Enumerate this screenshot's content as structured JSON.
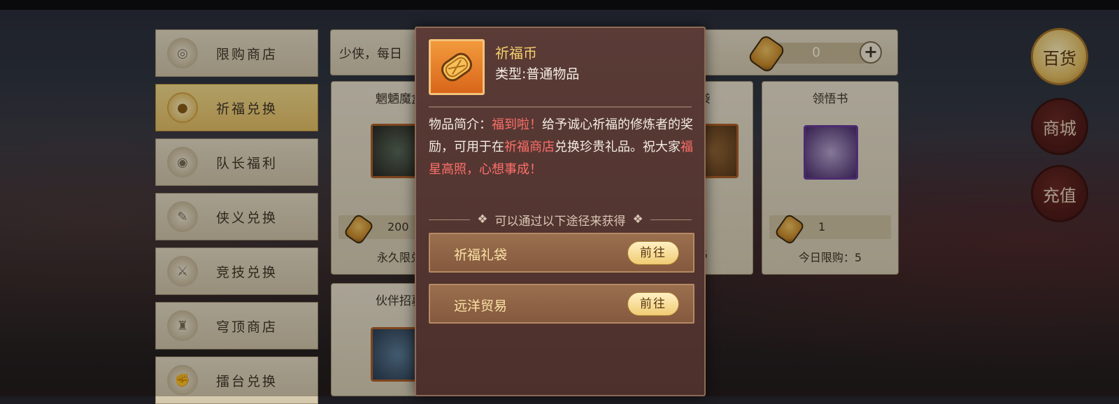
{
  "menu": {
    "items": [
      {
        "label": "限购商店",
        "icon": "bun-icon",
        "active": false
      },
      {
        "label": "祈福兑换",
        "icon": "coin-icon",
        "active": true
      },
      {
        "label": "队长福利",
        "icon": "pouch-icon",
        "active": false
      },
      {
        "label": "侠义兑换",
        "icon": "scroll-icon",
        "active": false
      },
      {
        "label": "竞技兑换",
        "icon": "swords-icon",
        "active": false
      },
      {
        "label": "穹顶商店",
        "icon": "bell-icon",
        "active": false
      },
      {
        "label": "擂台兑换",
        "icon": "fist-icon",
        "active": false
      }
    ]
  },
  "infobar": {
    "text": "少侠，每日",
    "currency_value": "0",
    "plus_label": "+"
  },
  "cards": [
    {
      "title": "魍魉魔盒",
      "price": "200",
      "limit": "永久限兑"
    },
    {
      "title": "伙伴招募",
      "price": "",
      "limit": ""
    },
    {
      "title": "袋",
      "price": "",
      "limit": "5"
    },
    {
      "title": "领悟书",
      "price": "1",
      "limit": "今日限购：5"
    }
  ],
  "right_buttons": [
    {
      "label": "百货",
      "active": true
    },
    {
      "label": "商城",
      "active": false
    },
    {
      "label": "充值",
      "active": false
    }
  ],
  "popup": {
    "name": "祈福币",
    "type": "类型:普通物品",
    "desc_prefix": "物品简介：",
    "desc_hl1": "福到啦！",
    "desc_text1": "给予诚心祈福的修炼者的奖励，可用于在",
    "desc_hl2": "祈福商店",
    "desc_text2": "兑换珍贵礼品。祝大家",
    "desc_hl3": "福星高照，心想事成！",
    "source_header": "可以通过以下途径来获得",
    "sources": [
      {
        "name": "祈福礼袋",
        "button": "前往"
      },
      {
        "name": "远洋贸易",
        "button": "前往"
      }
    ]
  },
  "colors": {
    "accent_gold": "#f5cf6e",
    "highlight_red": "#ff6f6a",
    "popup_bg": "#523430"
  }
}
